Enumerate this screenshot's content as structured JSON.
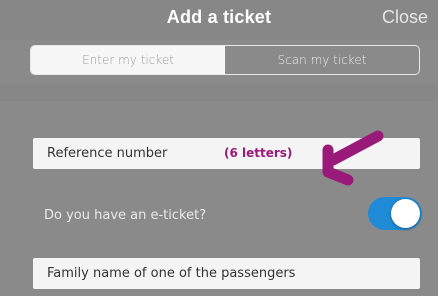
{
  "header": {
    "title": "Add a ticket",
    "close_label": "Close"
  },
  "segments": {
    "items": [
      {
        "label": "Enter my ticket",
        "selected": true
      },
      {
        "label": "Scan my ticket",
        "selected": false
      }
    ]
  },
  "form": {
    "reference_label": "Reference number",
    "reference_hint": "(6 letters)",
    "eticket_label": "Do you have an e-ticket?",
    "eticket_enabled": true,
    "family_name_label": "Family name of one of the passengers"
  },
  "colors": {
    "background": "#8a8a8a",
    "toggle_on": "#1f8bd6",
    "annotation": "#9a1a7a"
  },
  "icons": {
    "annotation_arrow": "arrow-icon"
  }
}
